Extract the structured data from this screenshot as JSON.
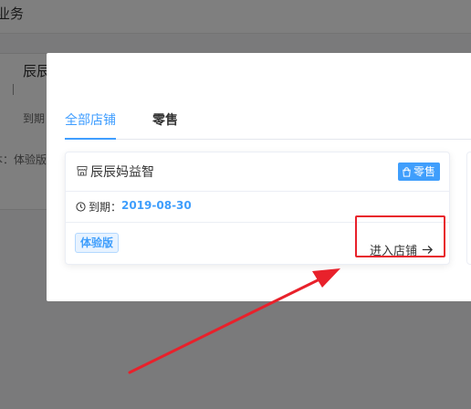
{
  "background": {
    "header_title": "业务",
    "card": {
      "title": "辰辰",
      "expire_label": "到期",
      "version_label": "本：体验版"
    }
  },
  "modal": {
    "tabs": [
      {
        "label": "全部店铺",
        "active": true
      },
      {
        "label": "零售",
        "active": false
      }
    ],
    "store_card": {
      "icon": "store-icon",
      "name": "辰辰妈益智",
      "type_badge": "零售",
      "type_badge_icon": "shopping-bag-icon",
      "expire_label": "到期：",
      "expire_date": "2019-08-30",
      "version": "体验版",
      "enter_label": "进入店铺",
      "enter_icon": "arrow-right-icon"
    }
  },
  "colors": {
    "accent": "#409eff",
    "badge_blue": "#3f9efc",
    "annotation_red": "#e8212b",
    "overlay": "rgba(0,0,0,0.5)"
  }
}
